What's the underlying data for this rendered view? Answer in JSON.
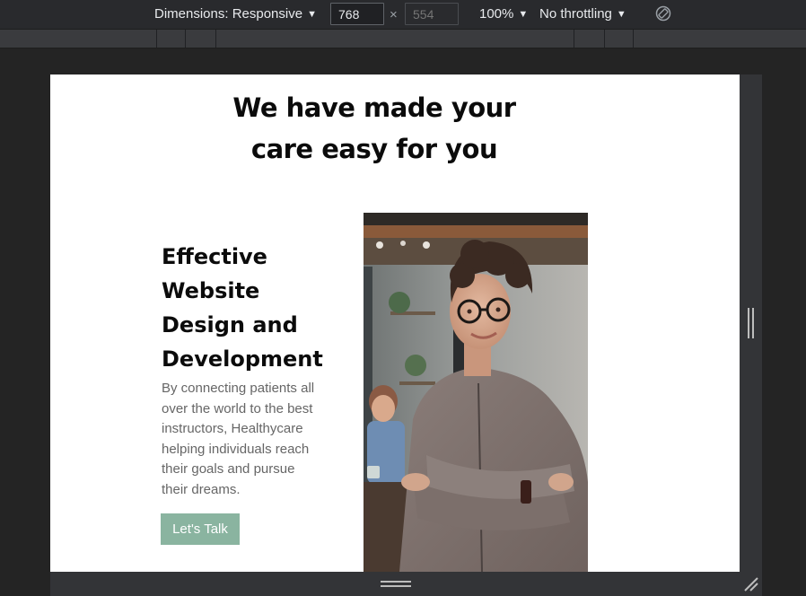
{
  "devtools": {
    "dimensions_label": "Dimensions: Responsive",
    "width_value": "768",
    "height_placeholder": "554",
    "times_symbol": "×",
    "zoom_label": "100%",
    "throttling_label": "No throttling",
    "caret": "▼"
  },
  "page": {
    "hero_title_lines": [
      "We have made your",
      "care easy for you"
    ],
    "card": {
      "heading_lines": [
        "Effective",
        "Website",
        "Design and",
        "Development"
      ],
      "body_lines": [
        "By connecting patients all",
        "over the world to the best",
        "instructors, Healthycare",
        "helping individuals reach",
        "their goals and pursue",
        "their dreams."
      ],
      "button_label": "Let's Talk"
    }
  },
  "colors": {
    "toolbar_bg": "#292a2d",
    "frame_bg": "#242424",
    "button_bg": "#8ab4a0",
    "heading_color": "#0b0b0b",
    "body_text_color": "#666666"
  },
  "icons": {
    "rotate": "rotate-device-icon",
    "resize_side": "resize-handle-icon",
    "resize_bottom": "resize-handle-icon",
    "resize_corner": "resize-corner-icon"
  }
}
